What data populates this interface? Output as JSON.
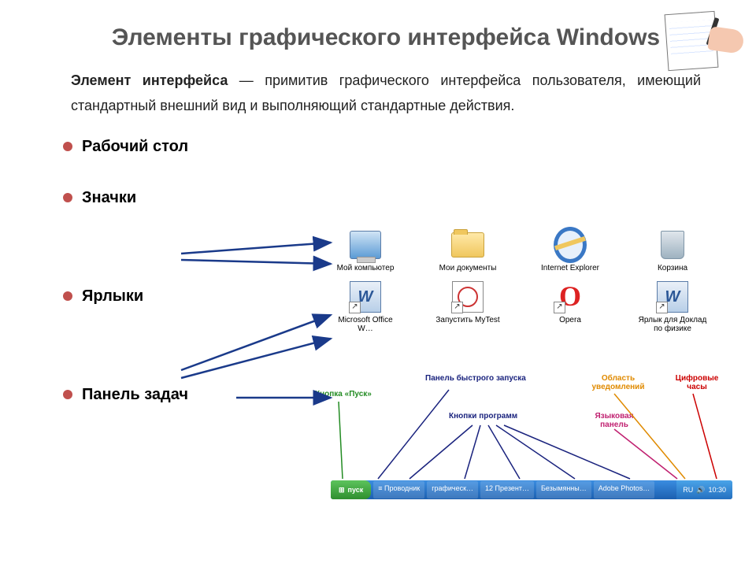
{
  "title": "Элементы графического интерфейса Windows",
  "definition": {
    "term": "Элемент интерфейса",
    "rest": " — примитив графического интерфейса пользователя, имеющий стандартный внешний вид и выполняющий стандартные действия."
  },
  "bullets": {
    "b1": "Рабочий стол",
    "b2": "Значки",
    "b3": "Ярлыки",
    "b4": "Панель задач"
  },
  "icons_row1": [
    {
      "label": "Мой компьютер",
      "name": "my-computer-icon"
    },
    {
      "label": "Мои документы",
      "name": "my-documents-icon"
    },
    {
      "label": "Internet Explorer",
      "name": "ie-icon"
    },
    {
      "label": "Корзина",
      "name": "recycle-bin-icon"
    }
  ],
  "icons_row2": [
    {
      "label": "Microsoft Office W…",
      "name": "ms-word-shortcut-icon"
    },
    {
      "label": "Запустить MyTest",
      "name": "mytest-shortcut-icon"
    },
    {
      "label": "Opera",
      "name": "opera-shortcut-icon"
    },
    {
      "label": "Ярлык для Доклад по физике",
      "name": "doc-shortcut-icon"
    }
  ],
  "taskbar_labels": {
    "start": "Кнопка «Пуск»",
    "quicklaunch": "Панель быстрого запуска",
    "programs": "Кнопки программ",
    "tray": "Область уведомлений",
    "lang": "Языковая панель",
    "clock": "Цифровые часы"
  },
  "taskbar": {
    "start": "пуск",
    "btns": [
      "≡ Проводник",
      "грaфическ…",
      "12 Презент…",
      "Безымянны…",
      "Adobe Photos…"
    ],
    "lang": "RU",
    "time": "10:30"
  }
}
